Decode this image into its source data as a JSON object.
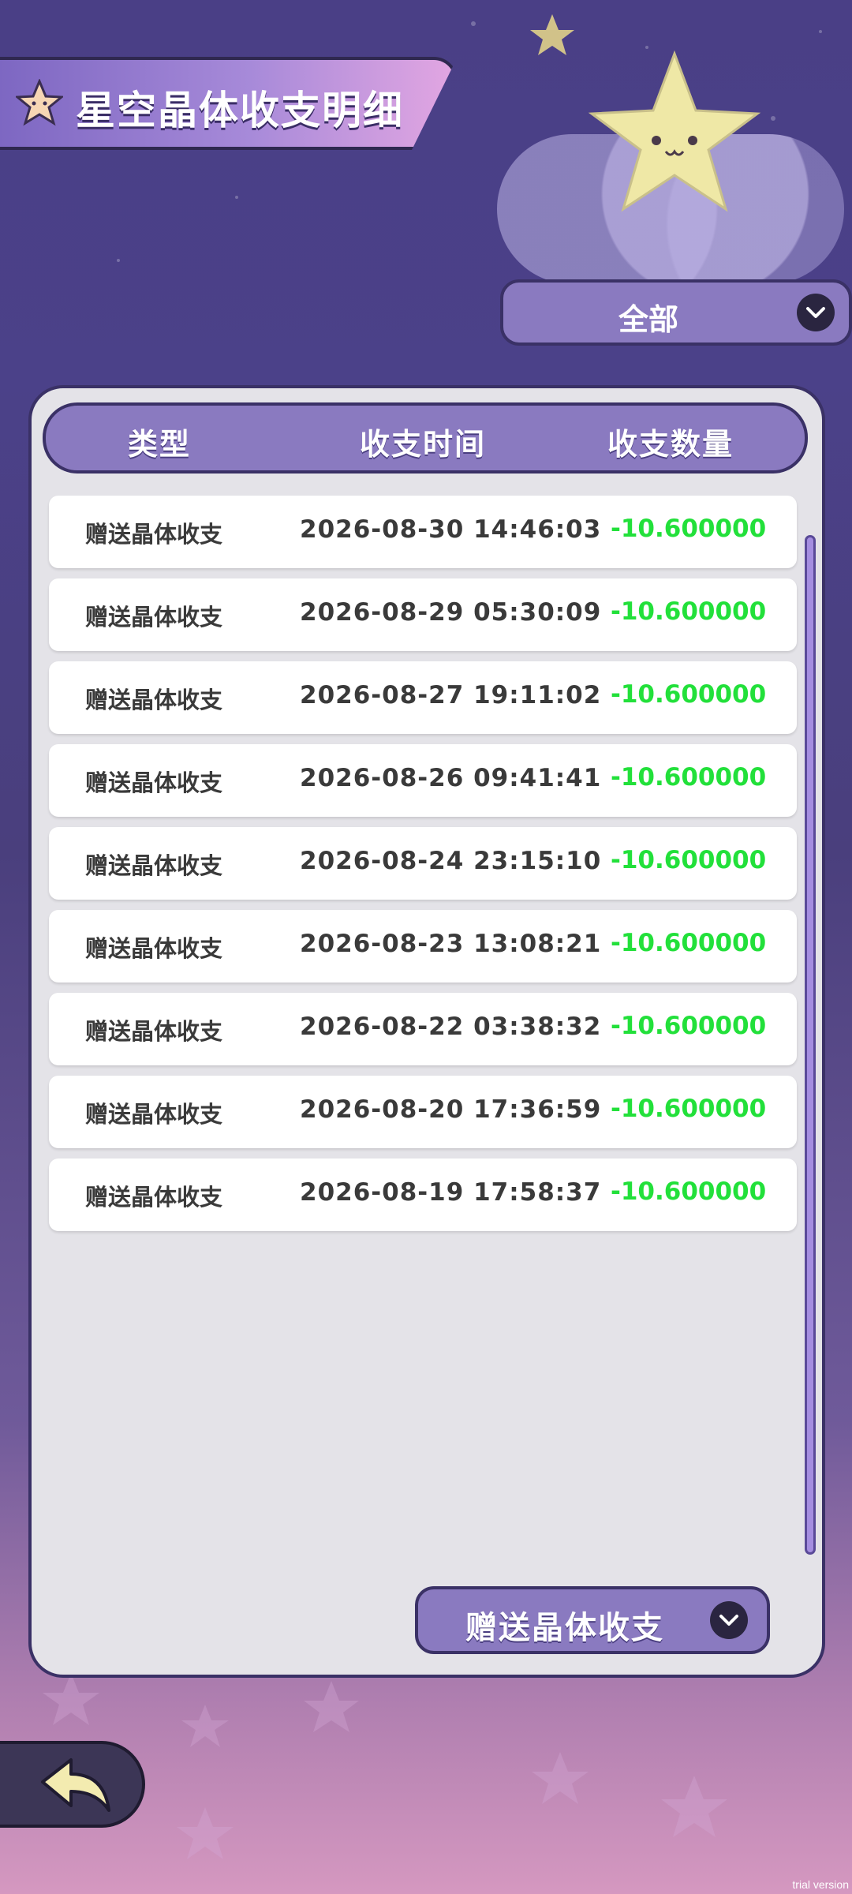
{
  "title": "星空晶体收支明细",
  "filter": {
    "selected": "全部"
  },
  "table": {
    "headers": {
      "type": "类型",
      "time": "收支时间",
      "amount": "收支数量"
    },
    "rows": [
      {
        "type": "赠送晶体收支",
        "time": "2026-08-30 14:46:03",
        "amount": "-10.600000"
      },
      {
        "type": "赠送晶体收支",
        "time": "2026-08-29 05:30:09",
        "amount": "-10.600000"
      },
      {
        "type": "赠送晶体收支",
        "time": "2026-08-27 19:11:02",
        "amount": "-10.600000"
      },
      {
        "type": "赠送晶体收支",
        "time": "2026-08-26 09:41:41",
        "amount": "-10.600000"
      },
      {
        "type": "赠送晶体收支",
        "time": "2026-08-24 23:15:10",
        "amount": "-10.600000"
      },
      {
        "type": "赠送晶体收支",
        "time": "2026-08-23 13:08:21",
        "amount": "-10.600000"
      },
      {
        "type": "赠送晶体收支",
        "time": "2026-08-22 03:38:32",
        "amount": "-10.600000"
      },
      {
        "type": "赠送晶体收支",
        "time": "2026-08-20 17:36:59",
        "amount": "-10.600000"
      },
      {
        "type": "赠送晶体收支",
        "time": "2026-08-19 17:58:37",
        "amount": "-10.600000"
      }
    ]
  },
  "category": {
    "selected": "赠送晶体收支"
  },
  "watermark": "trial version",
  "colors": {
    "panel": "#e4e3e8",
    "accent": "#8a7ac0",
    "amount_negative": "#22e03a",
    "border": "#3a3166"
  },
  "icons": {
    "title": "star-icon",
    "dropdown": "chevron-down-icon",
    "back": "back-arrow-icon",
    "mascot": "star-mascot"
  }
}
